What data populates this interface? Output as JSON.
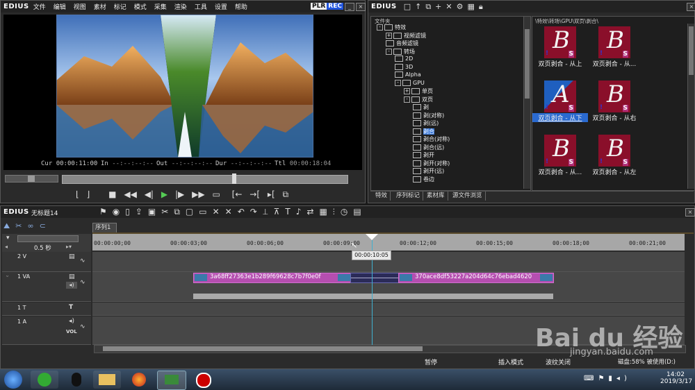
{
  "player": {
    "app_name": "EDIUS",
    "menu": [
      "文件",
      "编辑",
      "视图",
      "素材",
      "标记",
      "模式",
      "采集",
      "渲染",
      "工具",
      "设置",
      "帮助"
    ],
    "plr": "PLR",
    "rec": "REC",
    "cur_label": "Cur",
    "cur_value": "00:00:11:00",
    "in_label": "In",
    "in_value": "--:--:--:--",
    "out_label": "Out",
    "out_value": "--:--:--:--",
    "dur_label": "Dur",
    "dur_value": "--:--:--:--",
    "ttl_label": "Ttl",
    "ttl_value": "00:00:18:04"
  },
  "bin": {
    "app_name": "EDIUS",
    "folder_header": "文件夹",
    "path": "\\特效\\转场\\GPU\\双页\\剥合\\",
    "tree": [
      {
        "label": "特效",
        "indent": 0,
        "box": "-"
      },
      {
        "label": "视频滤镜",
        "indent": 1,
        "box": "+"
      },
      {
        "label": "音频滤镜",
        "indent": 1,
        "box": ""
      },
      {
        "label": "转场",
        "indent": 1,
        "box": "-"
      },
      {
        "label": "2D",
        "indent": 2,
        "box": ""
      },
      {
        "label": "3D",
        "indent": 2,
        "box": ""
      },
      {
        "label": "Alpha",
        "indent": 2,
        "box": ""
      },
      {
        "label": "GPU",
        "indent": 2,
        "box": "-"
      },
      {
        "label": "单页",
        "indent": 3,
        "box": "+"
      },
      {
        "label": "双页",
        "indent": 3,
        "box": "-"
      },
      {
        "label": "剥",
        "indent": 4,
        "box": ""
      },
      {
        "label": "剥(对称)",
        "indent": 4,
        "box": ""
      },
      {
        "label": "剥(远)",
        "indent": 4,
        "box": ""
      },
      {
        "label": "剥合",
        "indent": 4,
        "box": "",
        "selected": true
      },
      {
        "label": "剥合(对称)",
        "indent": 4,
        "box": ""
      },
      {
        "label": "剥合(远)",
        "indent": 4,
        "box": ""
      },
      {
        "label": "剥开",
        "indent": 4,
        "box": ""
      },
      {
        "label": "剥开(对称)",
        "indent": 4,
        "box": ""
      },
      {
        "label": "剥开(远)",
        "indent": 4,
        "box": ""
      },
      {
        "label": "卷边",
        "indent": 4,
        "box": ""
      }
    ],
    "thumbs": [
      {
        "label": "双页剥合 - 从上"
      },
      {
        "label": "双页剥合 - 从..."
      },
      {
        "label": "双页剥合 - 从下",
        "selected": true
      },
      {
        "label": "双页剥合 - 从右"
      },
      {
        "label": "双页剥合 - 从..."
      },
      {
        "label": "双页剥合 - 从左"
      }
    ],
    "tabs": [
      "特效",
      "序列标记",
      "素材库",
      "源文件浏览"
    ]
  },
  "timeline": {
    "app_name": "EDIUS",
    "project_name": "无标题14",
    "sequence_tab": "序列1",
    "zoom": "0.5 秒",
    "ruler": [
      "00:00:00;00",
      "00:00:03;00",
      "00:00:06;00",
      "00:00:09;00",
      "00:00:12;00",
      "00:00:15;00",
      "00:00:18;00",
      "00:00:21;00"
    ],
    "playhead_time": "00:00:10:05",
    "tracks": {
      "v2": "2 V",
      "va1": "1 VA",
      "t1": "1 T",
      "a1": "1 A",
      "vol": "VOL"
    },
    "clip1_name": "3a68ff27363e1b289f69628c7b7f0e0f",
    "clip2_name": "370ace8df53227a204d64c76ebad4620",
    "status": [
      "暂停",
      "插入模式",
      "波纹关闭",
      "磁盘:58% 被使用(D:)"
    ]
  },
  "taskbar": {
    "time": "14:02",
    "date": "2019/3/17"
  },
  "watermark": {
    "text": "Bai du 经验",
    "url": "jingyan.baidu.com"
  }
}
